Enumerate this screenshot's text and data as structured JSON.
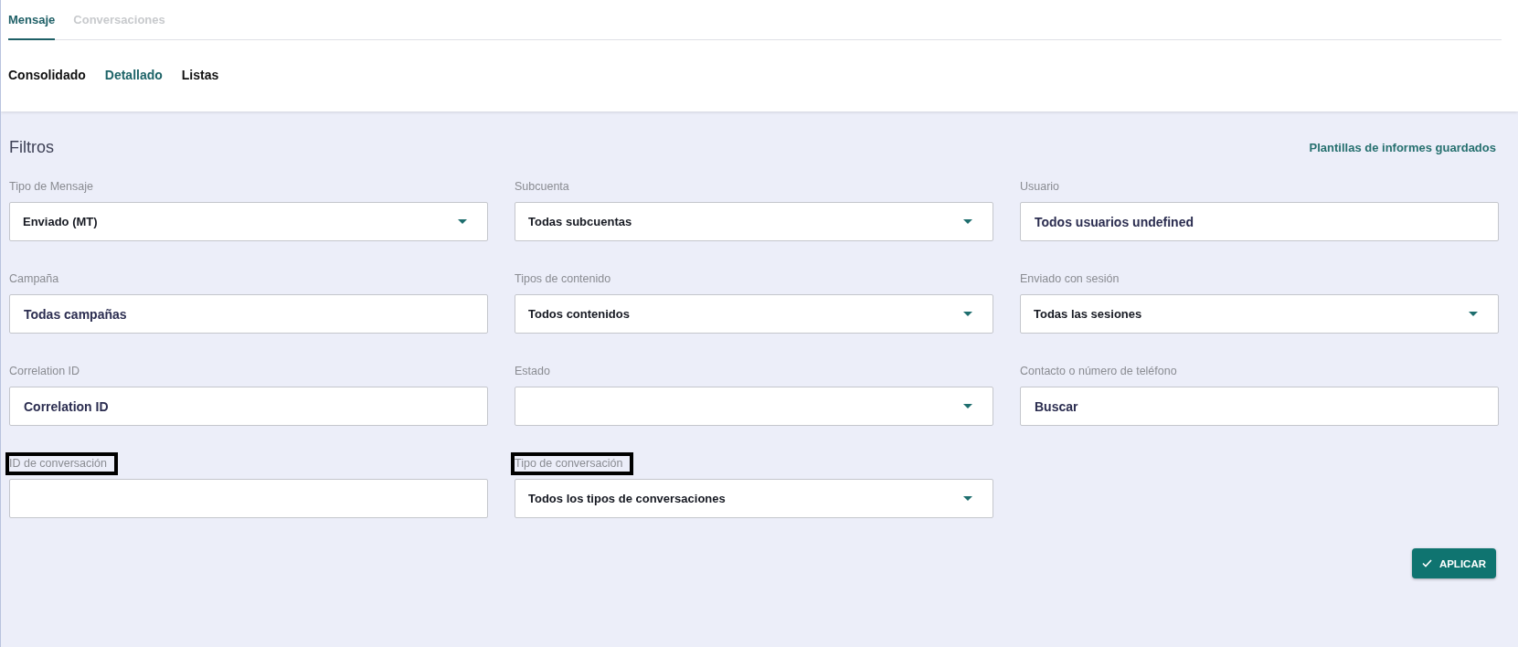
{
  "tabs": [
    {
      "label": "Mensaje",
      "selected": true
    },
    {
      "label": "Conversaciones",
      "selected": false
    }
  ],
  "subtabs": [
    {
      "label": "Consolidado",
      "selected": false
    },
    {
      "label": "Detallado",
      "selected": true
    },
    {
      "label": "Listas",
      "selected": false
    }
  ],
  "filters": {
    "title": "Filtros",
    "saved_templates_link": "Plantillas de informes guardados",
    "fields": [
      {
        "label": "Tipo de Mensaje",
        "kind": "select",
        "value": "Enviado (MT)",
        "highlighted": false
      },
      {
        "label": "Subcuenta",
        "kind": "select",
        "value": "Todas subcuentas",
        "highlighted": false
      },
      {
        "label": "Usuario",
        "kind": "input",
        "placeholder": "Todos usuarios undefined",
        "highlighted": false
      },
      {
        "label": "Campaña",
        "kind": "input",
        "placeholder": "Todas campañas",
        "highlighted": false
      },
      {
        "label": "Tipos de contenido",
        "kind": "select",
        "value": "Todos contenidos",
        "highlighted": false
      },
      {
        "label": "Enviado con sesión",
        "kind": "select",
        "value": "Todas las sesiones",
        "highlighted": false
      },
      {
        "label": "Correlation ID",
        "kind": "input",
        "placeholder": "Correlation ID",
        "highlighted": false
      },
      {
        "label": "Estado",
        "kind": "select",
        "highlighted": false
      },
      {
        "label": "Contacto o número de teléfono",
        "kind": "input",
        "placeholder": "Buscar",
        "highlighted": false
      },
      {
        "label": "ID de conversación",
        "kind": "input",
        "highlighted": true
      },
      {
        "label": "Tipo de conversación",
        "kind": "select",
        "value": "Todos los tipos de conversaciones",
        "highlighted": true
      }
    ],
    "apply_button": "APLICAR"
  }
}
